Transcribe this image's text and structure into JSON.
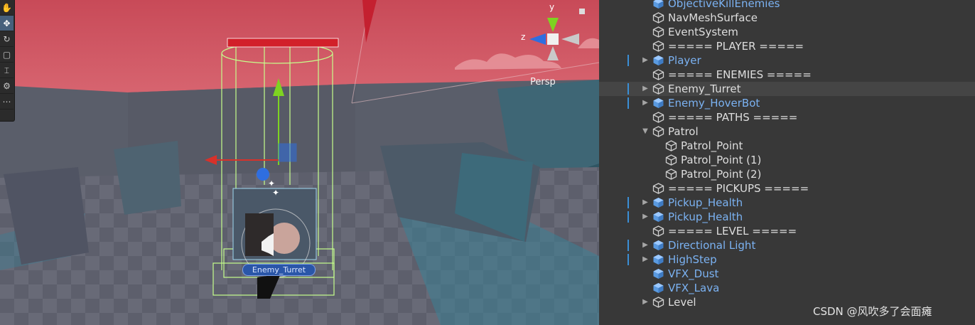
{
  "scene_view": {
    "camera_mode": "Persp",
    "selected_object_label": "Enemy_Turret",
    "gizmo_axes": {
      "y": "y",
      "z": "z"
    },
    "tool_icons": [
      "view-tool-icon",
      "move-tool-icon",
      "rotate-tool-icon",
      "scale-tool-icon",
      "rect-tool-icon",
      "transform-tool-icon",
      "custom-tool-icon"
    ],
    "colors": {
      "sky": "#c8505d",
      "floor": "#5b5d6a",
      "wall": "#4d6876",
      "selection": "#c6ff8c",
      "x_axis": "#d8312a",
      "y_axis": "#7ed321",
      "z_axis": "#2f6ee0"
    }
  },
  "hierarchy": {
    "items": [
      {
        "label": "ObjectiveKillEnemies",
        "prefab": true,
        "indent": 0,
        "expand": "none",
        "edge": false
      },
      {
        "label": "NavMeshSurface",
        "prefab": false,
        "indent": 0,
        "expand": "none",
        "edge": false
      },
      {
        "label": "EventSystem",
        "prefab": false,
        "indent": 0,
        "expand": "none",
        "edge": false
      },
      {
        "label": "===== PLAYER =====",
        "prefab": false,
        "indent": 0,
        "expand": "none",
        "edge": false
      },
      {
        "label": "Player",
        "prefab": true,
        "indent": 0,
        "expand": "collapsed",
        "edge": true
      },
      {
        "label": "===== ENEMIES =====",
        "prefab": false,
        "indent": 0,
        "expand": "none",
        "edge": false
      },
      {
        "label": "Enemy_Turret",
        "prefab": false,
        "indent": 0,
        "expand": "collapsed",
        "edge": true,
        "hover": true
      },
      {
        "label": "Enemy_HoverBot",
        "prefab": true,
        "indent": 0,
        "expand": "collapsed",
        "edge": true
      },
      {
        "label": "===== PATHS =====",
        "prefab": false,
        "indent": 0,
        "expand": "none",
        "edge": false
      },
      {
        "label": "Patrol",
        "prefab": false,
        "indent": 0,
        "expand": "expanded",
        "edge": false
      },
      {
        "label": "Patrol_Point",
        "prefab": false,
        "indent": 1,
        "expand": "none",
        "edge": false
      },
      {
        "label": "Patrol_Point (1)",
        "prefab": false,
        "indent": 1,
        "expand": "none",
        "edge": false
      },
      {
        "label": "Patrol_Point (2)",
        "prefab": false,
        "indent": 1,
        "expand": "none",
        "edge": false
      },
      {
        "label": "===== PICKUPS =====",
        "prefab": false,
        "indent": 0,
        "expand": "none",
        "edge": false
      },
      {
        "label": "Pickup_Health",
        "prefab": true,
        "indent": 0,
        "expand": "collapsed",
        "edge": true
      },
      {
        "label": "Pickup_Health",
        "prefab": true,
        "indent": 0,
        "expand": "collapsed",
        "edge": true
      },
      {
        "label": "===== LEVEL =====",
        "prefab": false,
        "indent": 0,
        "expand": "none",
        "edge": false
      },
      {
        "label": "Directional Light",
        "prefab": true,
        "indent": 0,
        "expand": "collapsed",
        "edge": true
      },
      {
        "label": "HighStep",
        "prefab": true,
        "indent": 0,
        "expand": "collapsed",
        "edge": true
      },
      {
        "label": "VFX_Dust",
        "prefab": true,
        "indent": 0,
        "expand": "none",
        "edge": false
      },
      {
        "label": "VFX_Lava",
        "prefab": true,
        "indent": 0,
        "expand": "none",
        "edge": false
      },
      {
        "label": "Level",
        "prefab": false,
        "indent": 0,
        "expand": "collapsed",
        "edge": false
      }
    ],
    "colors": {
      "prefab_text": "#7bb2f2",
      "text": "#dedede",
      "background": "#383838",
      "hover": "#454545"
    }
  },
  "watermark": "CSDN @风吹多了会面瘫"
}
